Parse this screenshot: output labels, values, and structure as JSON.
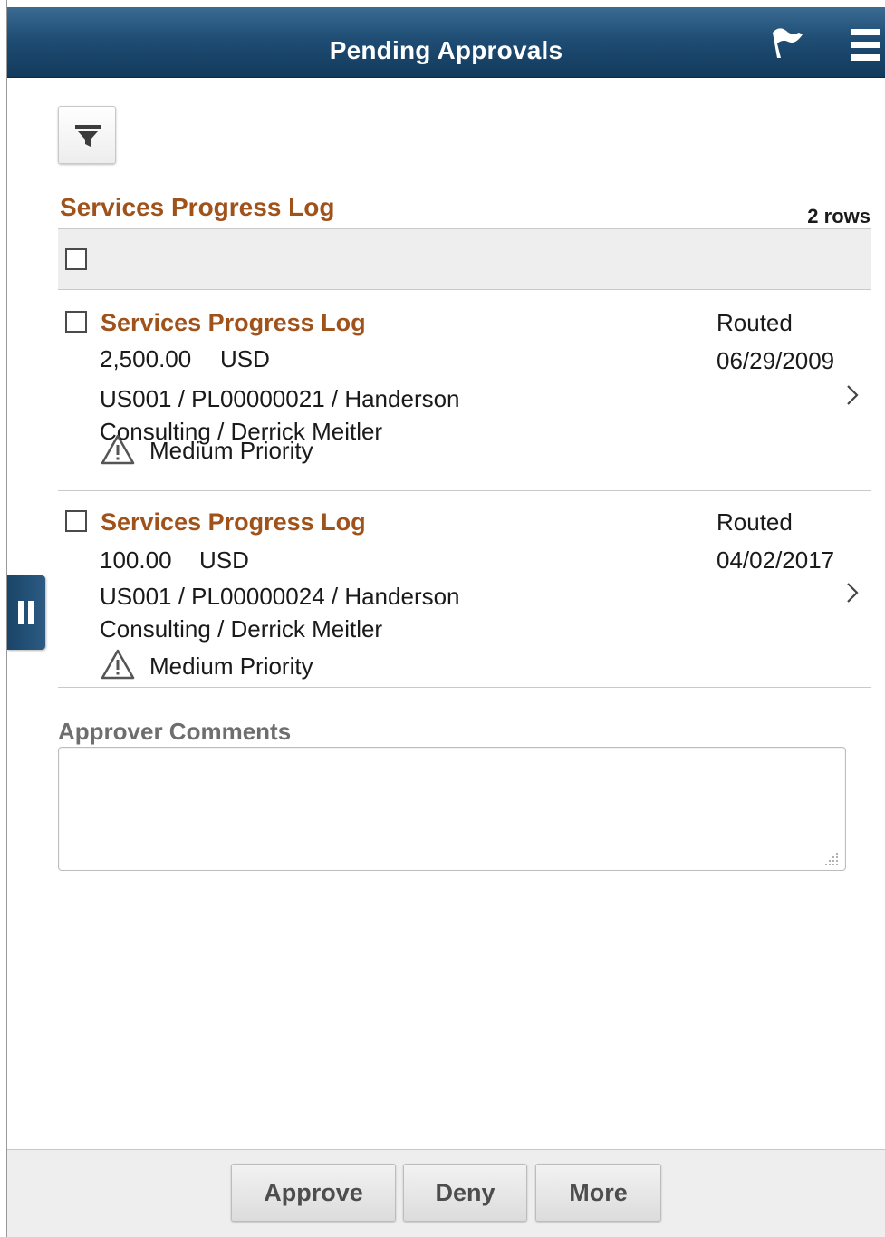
{
  "header": {
    "title": "Pending Approvals",
    "flag_icon": "flag-icon",
    "menu_icon": "hamburger-menu-icon",
    "background_color": "#1f4d74"
  },
  "filter": {
    "icon": "filter-funnel-icon"
  },
  "grid": {
    "title": "Services Progress Log",
    "row_count": "2 rows",
    "select_all_checked": false,
    "accent_color": "#a0521b",
    "items": [
      {
        "title": "Services Progress Log",
        "amount": "2,500.00",
        "currency": "USD",
        "line1": "US001 / PL00000021 / Handerson",
        "line2": "Consulting / Derrick Meitler",
        "priority": "Medium Priority",
        "priority_icon": "warning-triangle-icon",
        "status": "Routed",
        "date": "06/29/2009",
        "checked": false
      },
      {
        "title": "Services Progress Log",
        "amount": "100.00",
        "currency": "USD",
        "line1": "US001 / PL00000024 / Handerson",
        "line2": "Consulting / Derrick Meitler",
        "priority": "Medium Priority",
        "priority_icon": "warning-triangle-icon",
        "status": "Routed",
        "date": "04/02/2017",
        "checked": false
      }
    ]
  },
  "side_panel": {
    "icon": "pause-collapse-icon"
  },
  "comments": {
    "label": "Approver Comments",
    "value": ""
  },
  "footer": {
    "approve_label": "Approve",
    "deny_label": "Deny",
    "more_label": "More"
  }
}
